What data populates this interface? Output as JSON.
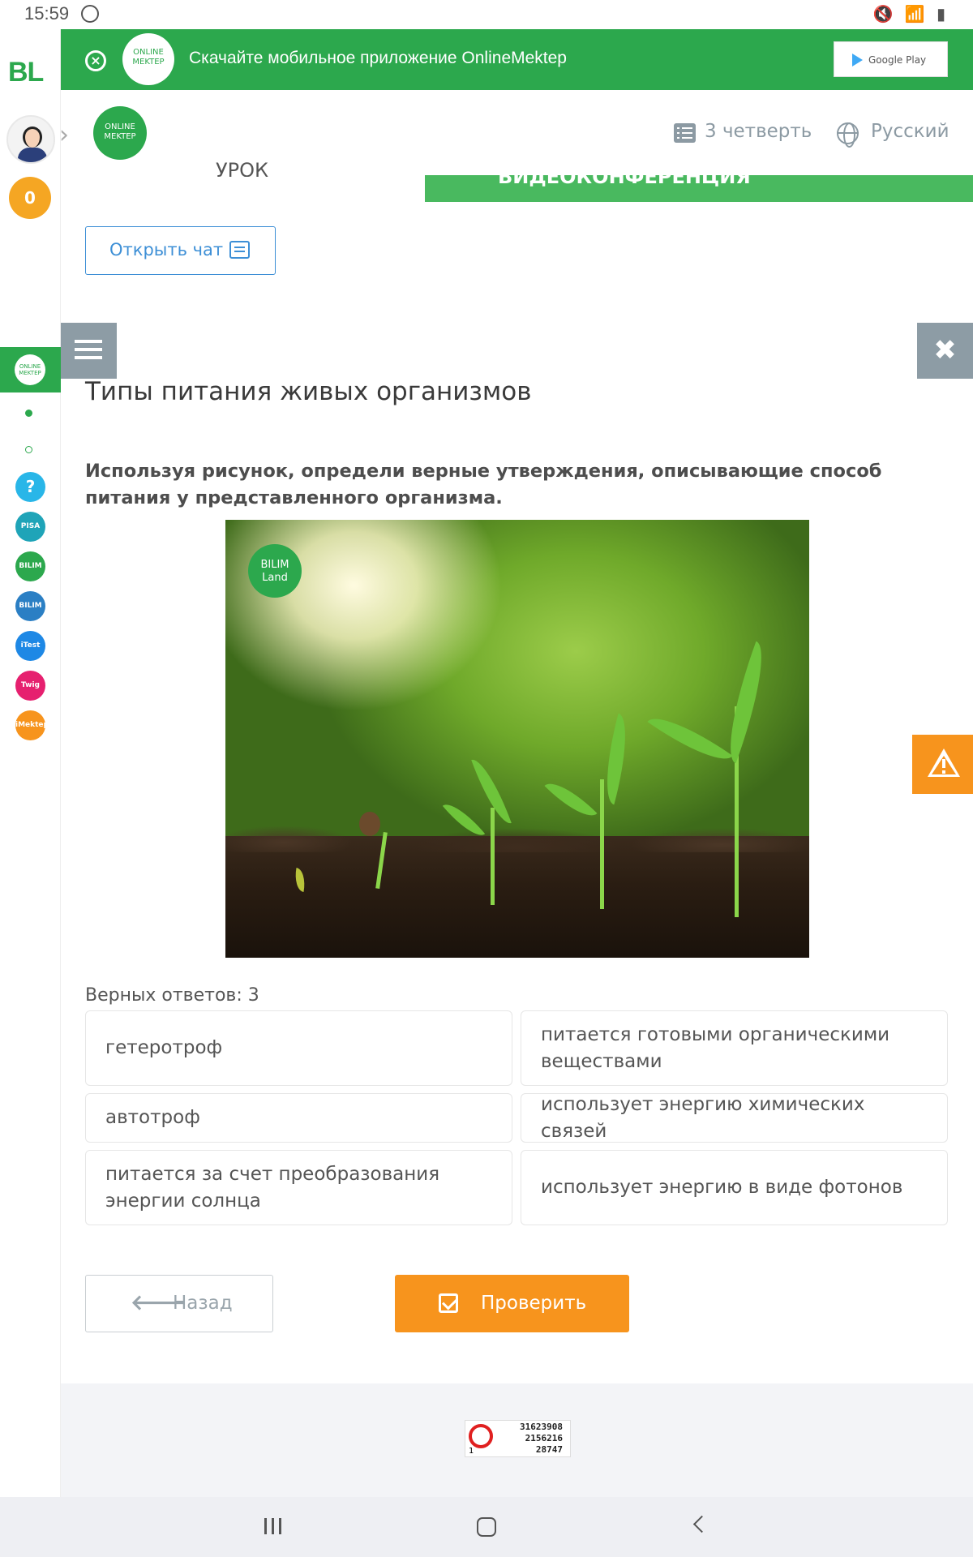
{
  "status_bar": {
    "time": "15:59",
    "right_icons": "🔇 📶 ▮"
  },
  "sidebar": {
    "logo": "BL",
    "coins": "0",
    "active_item": "ONLINE MEKTEP",
    "apps": [
      {
        "name": "help",
        "label": "?",
        "color": "#29b6e8"
      },
      {
        "name": "pisa",
        "label": "PISA",
        "color": "#1fa4b8"
      },
      {
        "name": "bilimland",
        "label": "BILIM Land",
        "color": "#2ca84d"
      },
      {
        "name": "bilimbook",
        "label": "BILIM Book",
        "color": "#2b7fc4"
      },
      {
        "name": "itest",
        "label": "iTest",
        "color": "#1e88e5"
      },
      {
        "name": "twig",
        "label": "Twig",
        "color": "#e6206f"
      },
      {
        "name": "imektep",
        "label": "iMektep",
        "color": "#f7941d"
      }
    ]
  },
  "banner": {
    "logo_text": "ONLINE MEKTEP",
    "text": "Скачайте мобильное приложение OnlineMektep",
    "store_label": "Google Play"
  },
  "header": {
    "logo_text": "ONLINE MEKTEP",
    "quarter": "3 четверть",
    "language": "Русский"
  },
  "top_content": {
    "cropped_left": "УРОК",
    "cropped_button": "ВИДЕОКОНФЕРЕНЦИЯ",
    "chat_button": "Открыть чат"
  },
  "task": {
    "title": "Типы питания живых организмов",
    "question": "Используя рисунок, определи верные утверждения, описывающие способ питания у представленного организма.",
    "image_badge": "BILIM Land",
    "answers_count": "Верных ответов: 3",
    "options": [
      "гетеротроф",
      "питается готовыми органическими веществами",
      "автотроф",
      "использует энергию химических связей",
      "питается за счет преобразования энергии солнца",
      "использует энергию в виде фотонов"
    ],
    "back_button": "Назад",
    "check_button": "Проверить"
  },
  "counter": {
    "lines": [
      "31623908",
      "2156216",
      "28747"
    ],
    "corner": "1"
  },
  "colors": {
    "brand_green": "#2ca84d",
    "accent_orange": "#f7941d",
    "link_blue": "#3d8fd6",
    "gray_button": "#8d9ca5"
  }
}
